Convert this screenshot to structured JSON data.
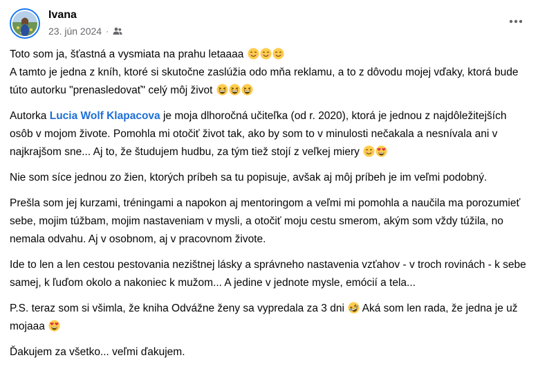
{
  "post": {
    "author": "Ivana",
    "date": "23. jún 2024",
    "separator": "·",
    "audience_icon": "friends-icon",
    "more_icon": "more-options-icon"
  },
  "content": {
    "p1_line1": "Toto som ja, šťastná a vysmiata na prahu letaaaa",
    "p1_line2": "A tamto je jedna z kníh, ktoré si skutočne zaslúžia odo mňa reklamu, a to z dôvodu mojej vďaky, ktorá bude túto autorku \"prenasledovať\" celý môj život",
    "p2_before": "Autorka",
    "p2_mention": "Lucia Wolf Klapacova",
    "p2_after": "je moja dlhoročná učiteľka (od r. 2020), ktorá je jednou z najdôležitejších osôb v mojom živote. Pomohla mi otočiť život tak, ako by som to v minulosti nečakala a nesnívala ani v najkrajšom sne... Aj to, že študujem hudbu, za tým tiež stojí z veľkej miery",
    "p3": "Nie som síce jednou zo žien, ktorých príbeh sa tu popisuje, avšak aj môj príbeh je im veľmi podobný.",
    "p4": "Prešla som jej kurzami, tréningami a napokon aj mentoringom a veľmi mi pomohla a naučila ma porozumieť sebe, mojim túžbam, mojim nastaveniam v mysli, a otočiť moju cestu smerom, akým som vždy túžila, no nemala odvahu. Aj v osobnom, aj v pracovnom živote.",
    "p5": "Ide to len a len cestou pestovania nezištnej lásky a správneho nastavenia vzťahov - v troch rovinách - k sebe samej, k ľuďom okolo a nakoniec k mužom... A jedine v jednote mysle, emócií a tela...",
    "p6_before": "P.S. teraz som si všimla, že kniha Odvážne ženy sa vypredala za 3 dni",
    "p6_middle": "Aká som len rada, že jedna je už mojaaa",
    "p7": "Ďakujem za všetko... veľmi ďakujem."
  },
  "emojis": {
    "smiling": "smiling-face-emoji",
    "grinning": "grinning-squinting-emoji",
    "heart_eyes": "heart-eyes-emoji",
    "rofl": "rolling-on-floor-laughing-emoji"
  },
  "colors": {
    "text": "#050505",
    "secondary": "#65676b",
    "mention": "#1d6fd6",
    "avatar_ring": "#1877f2"
  }
}
